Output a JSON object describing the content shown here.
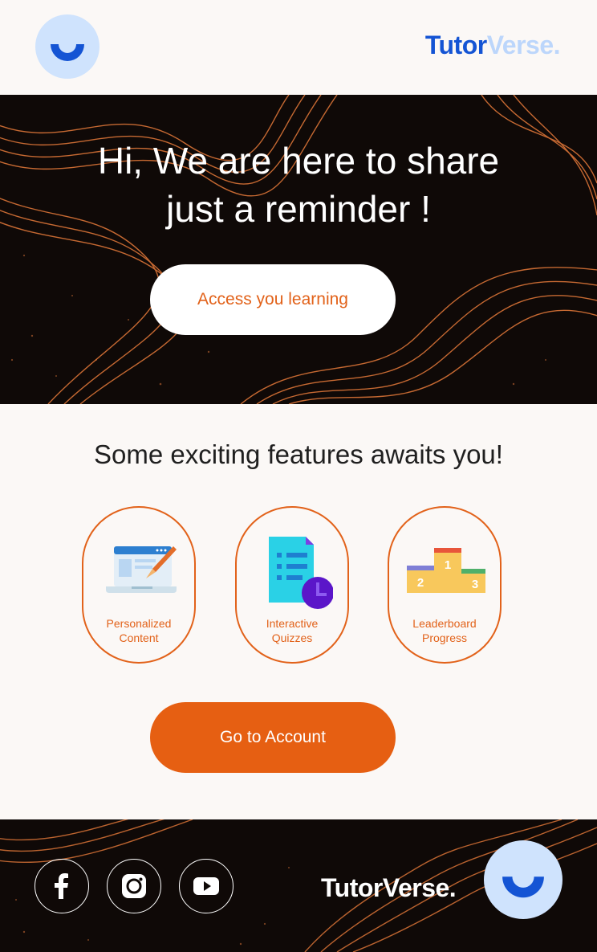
{
  "brand": {
    "name_part1": "Tutor",
    "name_part2": "Verse.",
    "footer_name": "TutorVerse."
  },
  "hero": {
    "title_line1": "Hi, We are here to share",
    "title_line2": "just a reminder !",
    "cta_label": "Access you learning"
  },
  "features": {
    "heading": "Some exciting features awaits you!",
    "items": [
      {
        "line1": "Personalized",
        "line2": "Content",
        "icon": "laptop-brush-icon"
      },
      {
        "line1": "Interactive",
        "line2": "Quizzes",
        "icon": "document-clock-icon"
      },
      {
        "line1": "Leaderboard",
        "line2": "Progress",
        "icon": "podium-icon"
      }
    ],
    "podium_ranks": [
      "2",
      "1",
      "3"
    ],
    "cta_label": "Go to Account"
  },
  "footer": {
    "social": [
      "facebook-icon",
      "instagram-icon",
      "youtube-icon"
    ]
  },
  "colors": {
    "accent": "#E65F12",
    "brand_blue": "#1454D4",
    "brand_light": "#CFE3FD",
    "dark": "#0F0907"
  }
}
